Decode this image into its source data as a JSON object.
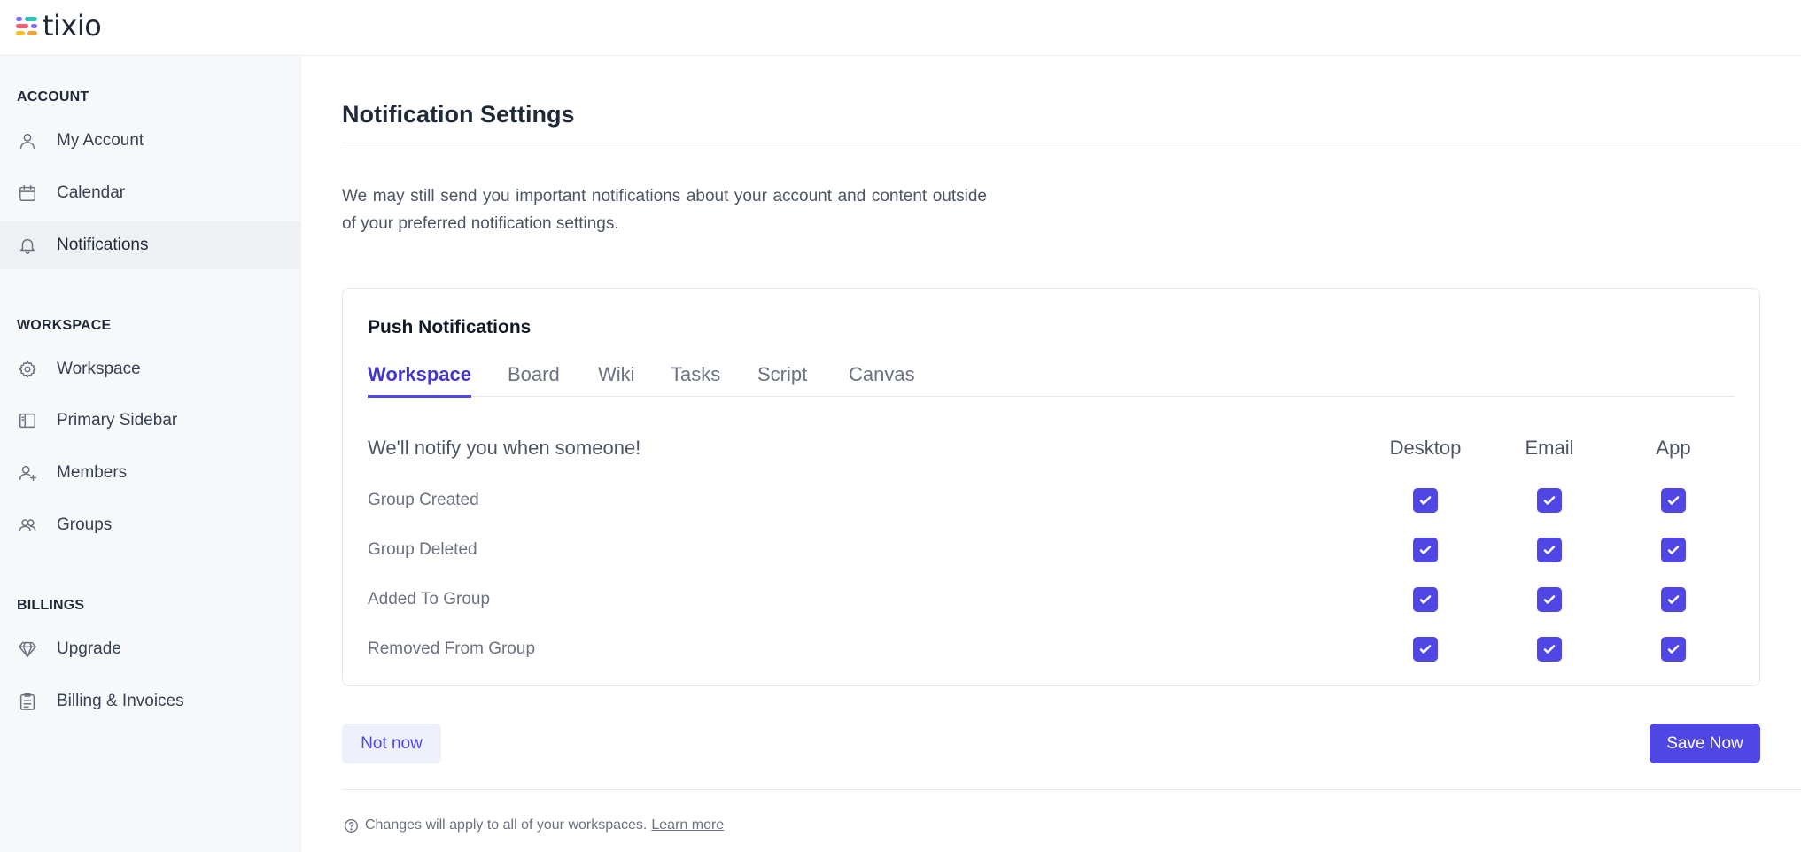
{
  "app": {
    "logo_text": "tixio",
    "logo_colors": [
      "#7c6cf2",
      "#f2a33a",
      "#2ec4b6",
      "#f25f7a",
      "#fbbf24"
    ]
  },
  "sidebar": {
    "sections": [
      {
        "title": "ACCOUNT"
      },
      {
        "title": "WORKSPACE"
      },
      {
        "title": "BILLINGS"
      }
    ],
    "items": [
      {
        "label": "My Account",
        "icon": "user-icon"
      },
      {
        "label": "Calendar",
        "icon": "calendar-icon"
      },
      {
        "label": "Notifications",
        "icon": "bell-icon",
        "active": true
      },
      {
        "label": "Workspace",
        "icon": "gear-icon"
      },
      {
        "label": "Primary Sidebar",
        "icon": "sidebar-layout-icon"
      },
      {
        "label": "Members",
        "icon": "user-plus-icon"
      },
      {
        "label": "Groups",
        "icon": "users-icon"
      },
      {
        "label": "Upgrade",
        "icon": "diamond-icon"
      },
      {
        "label": "Billing & Invoices",
        "icon": "clipboard-icon"
      }
    ]
  },
  "main": {
    "title": "Notification Settings",
    "intro": "We may still send you important notifications about your account and content outside of your preferred notification settings.",
    "card": {
      "title": "Push Notifications",
      "tabs": [
        {
          "label": "Workspace",
          "active": true
        },
        {
          "label": "Board"
        },
        {
          "label": "Wiki"
        },
        {
          "label": "Tasks"
        },
        {
          "label": "Script"
        },
        {
          "label": "Canvas"
        }
      ],
      "table": {
        "heading": "We'll notify you when someone!",
        "columns": [
          "Desktop",
          "Email",
          "App"
        ],
        "rows": [
          {
            "label": "Group Created",
            "desktop": true,
            "email": true,
            "app": true
          },
          {
            "label": "Group Deleted",
            "desktop": true,
            "email": true,
            "app": true
          },
          {
            "label": "Added To Group",
            "desktop": true,
            "email": true,
            "app": true
          },
          {
            "label": "Removed From Group",
            "desktop": true,
            "email": true,
            "app": true
          }
        ]
      }
    },
    "buttons": {
      "not_now": "Not now",
      "save": "Save Now"
    },
    "footer": {
      "note": "Changes will apply to all of your workspaces.",
      "link": "Learn more"
    }
  },
  "colors": {
    "accent": "#4f46e5",
    "sidebar_bg": "#f7f8fa"
  }
}
